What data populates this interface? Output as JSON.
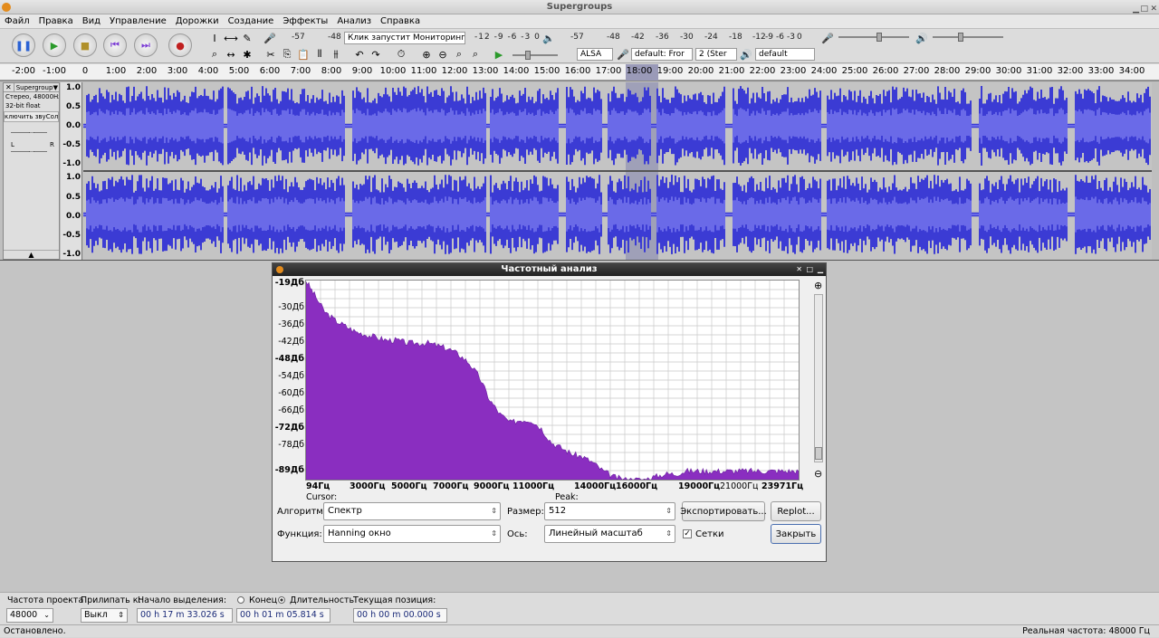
{
  "window": {
    "title": "Supergroups"
  },
  "menu": [
    "Файл",
    "Правка",
    "Вид",
    "Управление",
    "Дорожки",
    "Создание",
    "Эффекты",
    "Анализ",
    "Справка"
  ],
  "meters": {
    "record_scale": [
      "-57",
      "-48"
    ],
    "monitor_label": "Клик запустит Мониторинг",
    "record_scale_right": [
      "-12",
      "-9",
      "-6",
      "-3",
      "0"
    ],
    "play_scale": [
      "-57",
      "-48",
      "-42",
      "-36",
      "-30",
      "-24",
      "-18",
      "-12",
      "-9",
      "-6",
      "-3",
      "0"
    ]
  },
  "device": {
    "host": "ALSA",
    "input": "default: Fror",
    "channels": "2 (Ster",
    "output": "default"
  },
  "ruler_ticks": [
    "-2:00",
    "-1:00",
    "0",
    "1:00",
    "2:00",
    "3:00",
    "4:00",
    "5:00",
    "6:00",
    "7:00",
    "8:00",
    "9:00",
    "10:00",
    "11:00",
    "12:00",
    "13:00",
    "14:00",
    "15:00",
    "16:00",
    "17:00",
    "18:00",
    "19:00",
    "20:00",
    "21:00",
    "22:00",
    "23:00",
    "24:00",
    "25:00",
    "26:00",
    "27:00",
    "28:00",
    "29:00",
    "30:00",
    "31:00",
    "32:00",
    "33:00",
    "34:00"
  ],
  "track": {
    "name": "Supergroup",
    "format": "Стерео, 48000Hz",
    "bitdepth": "32-bit float",
    "mute_solo": "ключить звуСоло",
    "pan_left": "L",
    "pan_right": "R",
    "y_ticks": [
      "1.0",
      "0.5",
      "0.0",
      "-0.5",
      "-1.0"
    ]
  },
  "dialog": {
    "title": "Частотный анализ",
    "y_ticks": [
      "-19Дб",
      "-30Дб",
      "-36Дб",
      "-42Дб",
      "-48Дб",
      "-54Дб",
      "-60Дб",
      "-66Дб",
      "-72Дб",
      "-78Дб",
      "-89Дб"
    ],
    "x_ticks": [
      "94Гц",
      "3000Гц",
      "5000Гц",
      "7000Гц",
      "9000Гц",
      "11000Гц",
      "14000Гц",
      "16000Гц",
      "19000Гц",
      "21000Гц",
      "23971Гц"
    ],
    "cursor_label": "Cursor:",
    "peak_label": "Peak:",
    "algorithm_label": "Алгоритм:",
    "algorithm_value": "Спектр",
    "size_label": "Размер:",
    "size_value": "512",
    "export_button": "Экспортировать...",
    "replot_button": "Replot...",
    "function_label": "Функция:",
    "function_value": "Hanning окно",
    "axis_label": "Ось:",
    "axis_value": "Линейный масштаб",
    "grids_label": "Сетки",
    "grids_checked": true,
    "close_button": "Закрыть"
  },
  "chart_data": {
    "type": "area",
    "title": "",
    "xlabel": "",
    "ylabel": "",
    "xlim": [
      94,
      23971
    ],
    "ylim": [
      -89,
      -19
    ],
    "x": [
      94,
      500,
      1000,
      1500,
      2000,
      2500,
      3000,
      3500,
      4000,
      4500,
      5000,
      5500,
      6000,
      6500,
      7000,
      7500,
      8000,
      8500,
      9000,
      9500,
      10000,
      10500,
      11000,
      11500,
      12000,
      12500,
      13000,
      13500,
      14000,
      14500,
      15000,
      15500,
      16000,
      16500,
      17000,
      17500,
      18000,
      18500,
      19000,
      19500,
      20000,
      20500,
      21000,
      21500,
      22000,
      22500,
      23000,
      23500,
      23971
    ],
    "values": [
      -19,
      -24,
      -30,
      -33,
      -35,
      -37,
      -38,
      -39,
      -40,
      -40,
      -41,
      -41,
      -41,
      -42,
      -43,
      -45,
      -48,
      -53,
      -61,
      -66,
      -69,
      -68,
      -68,
      -71,
      -76,
      -78,
      -80,
      -81,
      -83,
      -86,
      -88,
      -89,
      -89,
      -89,
      -88,
      -87,
      -87,
      -86,
      -86,
      -86,
      -86,
      -86,
      -86,
      -86,
      -86,
      -86,
      -86,
      -86,
      -86
    ],
    "grid": true,
    "fill_color": "#8a2ec0"
  },
  "selection": {
    "rate_label": "Частота проекта",
    "rate_value": "48000",
    "snap_label": "Прилипать к:",
    "snap_value": "Выкл",
    "start_label": "Начало выделения:",
    "end_label": "Конец",
    "length_label": "Длительность",
    "start_value": "00 h 17 m 33.026 s",
    "length_value": "00 h 01 m 05.814 s",
    "position_label": "Текущая позиция:",
    "position_value": "00 h 00 m 00.000 s"
  },
  "status": {
    "left": "Остановлено.",
    "right": "Реальная частота: 48000 Гц"
  }
}
